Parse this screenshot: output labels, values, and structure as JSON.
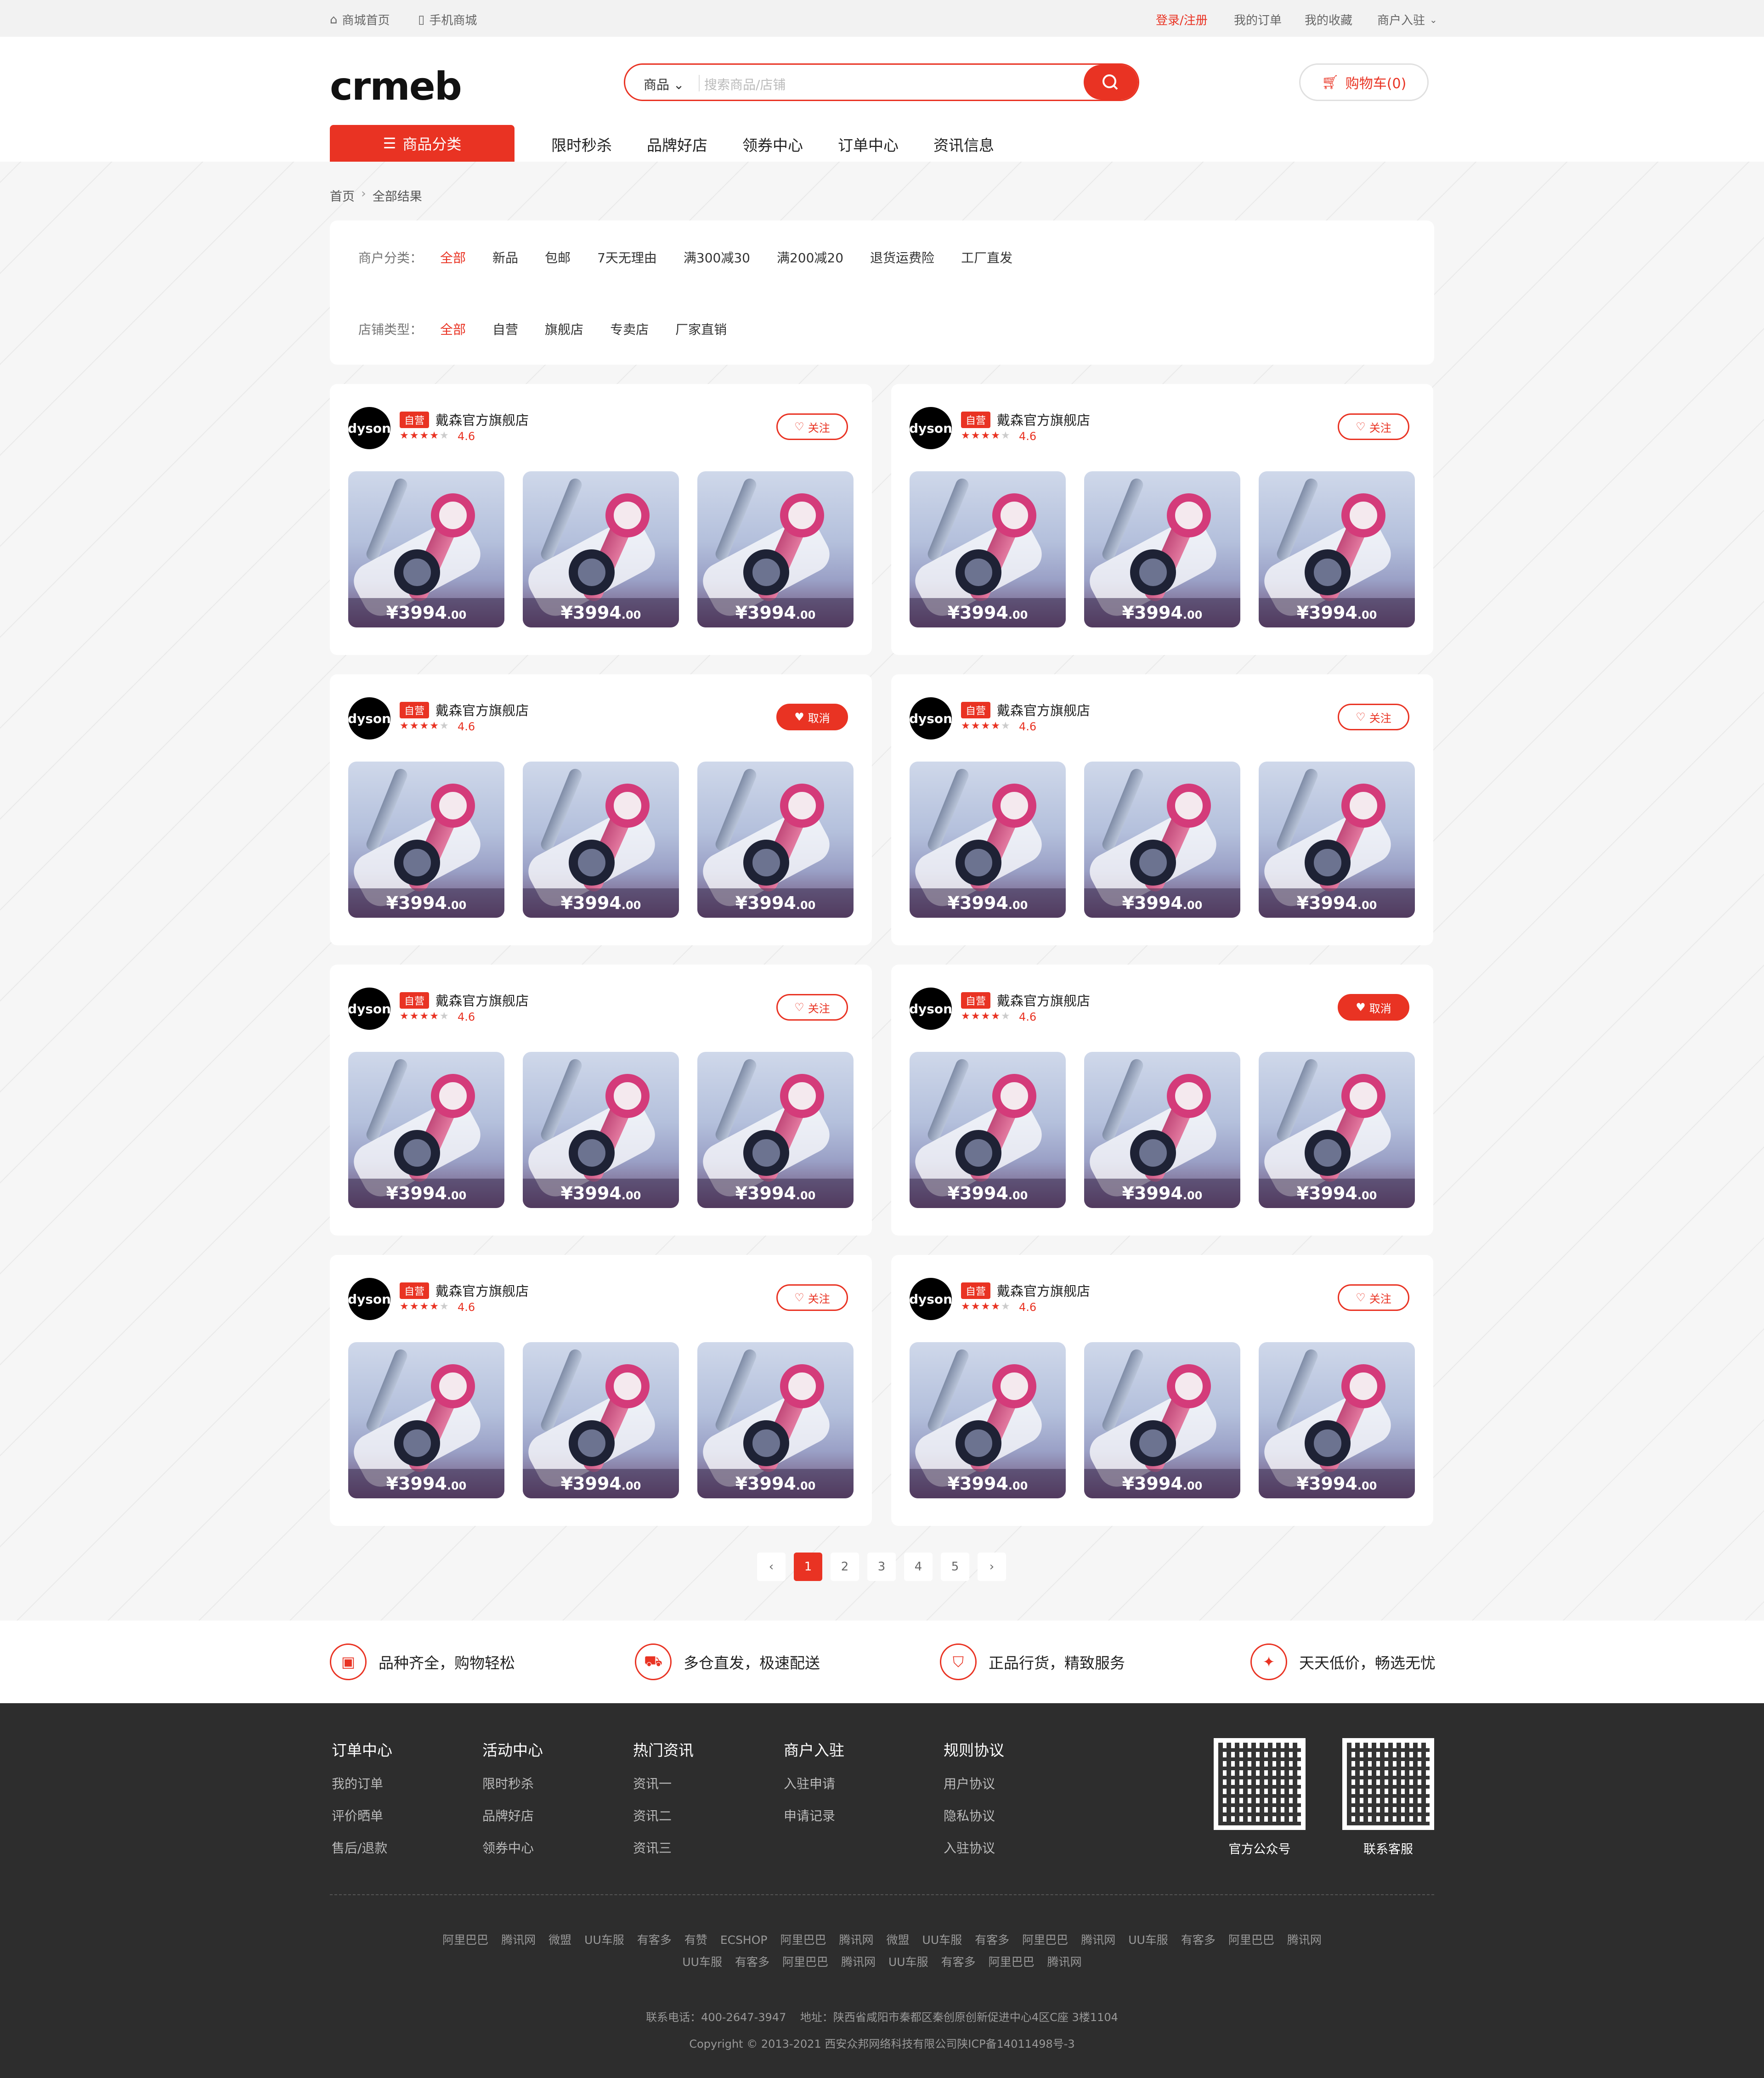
{
  "topbar": {
    "home": "商城首页",
    "mobile": "手机商城",
    "login": "登录/注册",
    "orders": "我的订单",
    "favorites": "我的收藏",
    "merchant": "商户入驻"
  },
  "header": {
    "logo": "crmeb",
    "search_category": "商品",
    "search_placeholder": "搜索商品/店铺",
    "cart": "购物车(0)"
  },
  "nav": {
    "category": "商品分类",
    "items": [
      "限时秒杀",
      "品牌好店",
      "领券中心",
      "订单中心",
      "资讯信息"
    ]
  },
  "breadcrumb": {
    "home": "首页",
    "current": "全部结果"
  },
  "filters": {
    "merchant_label": "商户分类：",
    "merchant_options": [
      "全部",
      "新品",
      "包邮",
      "7天无理由",
      "满300减30",
      "满200减20",
      "退货运费险",
      "工厂直发"
    ],
    "store_label": "店铺类型：",
    "store_options": [
      "全部",
      "自营",
      "旗舰店",
      "专卖店",
      "厂家直销"
    ]
  },
  "stores": [
    {
      "avatar": "dyson",
      "tag": "自营",
      "name": "戴森官方旗舰店",
      "rating": "4.6",
      "rating_value": 4,
      "follow": "关注",
      "followed": false,
      "products": [
        {
          "price": "3994",
          "cents": ".00"
        },
        {
          "price": "3994",
          "cents": ".00"
        },
        {
          "price": "3994",
          "cents": ".00"
        }
      ]
    },
    {
      "avatar": "dyson",
      "tag": "自营",
      "name": "戴森官方旗舰店",
      "rating": "4.6",
      "rating_value": 4,
      "follow": "关注",
      "followed": false,
      "products": [
        {
          "price": "3994",
          "cents": ".00"
        },
        {
          "price": "3994",
          "cents": ".00"
        },
        {
          "price": "3994",
          "cents": ".00"
        }
      ]
    },
    {
      "avatar": "dyson",
      "tag": "自营",
      "name": "戴森官方旗舰店",
      "rating": "4.6",
      "rating_value": 4,
      "follow": "取消",
      "followed": true,
      "products": [
        {
          "price": "3994",
          "cents": ".00"
        },
        {
          "price": "3994",
          "cents": ".00"
        },
        {
          "price": "3994",
          "cents": ".00"
        }
      ]
    },
    {
      "avatar": "dyson",
      "tag": "自营",
      "name": "戴森官方旗舰店",
      "rating": "4.6",
      "rating_value": 4,
      "follow": "关注",
      "followed": false,
      "products": [
        {
          "price": "3994",
          "cents": ".00"
        },
        {
          "price": "3994",
          "cents": ".00"
        },
        {
          "price": "3994",
          "cents": ".00"
        }
      ]
    },
    {
      "avatar": "dyson",
      "tag": "自营",
      "name": "戴森官方旗舰店",
      "rating": "4.6",
      "rating_value": 4,
      "follow": "关注",
      "followed": false,
      "products": [
        {
          "price": "3994",
          "cents": ".00"
        },
        {
          "price": "3994",
          "cents": ".00"
        },
        {
          "price": "3994",
          "cents": ".00"
        }
      ]
    },
    {
      "avatar": "dyson",
      "tag": "自营",
      "name": "戴森官方旗舰店",
      "rating": "4.6",
      "rating_value": 4,
      "follow": "取消",
      "followed": true,
      "products": [
        {
          "price": "3994",
          "cents": ".00"
        },
        {
          "price": "3994",
          "cents": ".00"
        },
        {
          "price": "3994",
          "cents": ".00"
        }
      ]
    },
    {
      "avatar": "dyson",
      "tag": "自营",
      "name": "戴森官方旗舰店",
      "rating": "4.6",
      "rating_value": 4,
      "follow": "关注",
      "followed": false,
      "products": [
        {
          "price": "3994",
          "cents": ".00"
        },
        {
          "price": "3994",
          "cents": ".00"
        },
        {
          "price": "3994",
          "cents": ".00"
        }
      ]
    },
    {
      "avatar": "dyson",
      "tag": "自营",
      "name": "戴森官方旗舰店",
      "rating": "4.6",
      "rating_value": 4,
      "follow": "关注",
      "followed": false,
      "products": [
        {
          "price": "3994",
          "cents": ".00"
        },
        {
          "price": "3994",
          "cents": ".00"
        },
        {
          "price": "3994",
          "cents": ".00"
        }
      ]
    }
  ],
  "currency": "¥",
  "pagination": {
    "prev": "‹",
    "pages": [
      "1",
      "2",
      "3",
      "4",
      "5"
    ],
    "current": "1",
    "next": "›"
  },
  "services": [
    "品种齐全，购物轻松",
    "多仓直发，极速配送",
    "正品行货，精致服务",
    "天天低价，畅选无忧"
  ],
  "footer": {
    "columns": [
      {
        "title": "订单中心",
        "links": [
          "我的订单",
          "评价晒单",
          "售后/退款"
        ]
      },
      {
        "title": "活动中心",
        "links": [
          "限时秒杀",
          "品牌好店",
          "领券中心"
        ]
      },
      {
        "title": "热门资讯",
        "links": [
          "资讯一",
          "资讯二",
          "资讯三"
        ]
      },
      {
        "title": "商户入驻",
        "links": [
          "入驻申请",
          "申请记录"
        ]
      },
      {
        "title": "规则协议",
        "links": [
          "用户协议",
          "隐私协议",
          "入驻协议"
        ]
      }
    ],
    "qr1_label": "官方公众号",
    "qr2_label": "联系客服",
    "links_row1": [
      "阿里巴巴",
      "腾讯网",
      "微盟",
      "UU车服",
      "有客多",
      "有赞",
      "ECSHOP",
      "阿里巴巴",
      "腾讯网",
      "微盟",
      "UU车服",
      "有客多",
      "阿里巴巴",
      "腾讯网",
      "UU车服",
      "有客多",
      "阿里巴巴",
      "腾讯网"
    ],
    "links_row2": [
      "UU车服",
      "有客多",
      "阿里巴巴",
      "腾讯网",
      "UU车服",
      "有客多",
      "阿里巴巴",
      "腾讯网"
    ],
    "phone": "联系电话：400-2647-3947",
    "address": "地址：陕西省咸阳市秦都区秦创原创新促进中心4区C座 3楼1104",
    "copyright": "Copyright © 2013-2021 西安众邦网络科技有限公司陕ICP备14011498号-3"
  }
}
